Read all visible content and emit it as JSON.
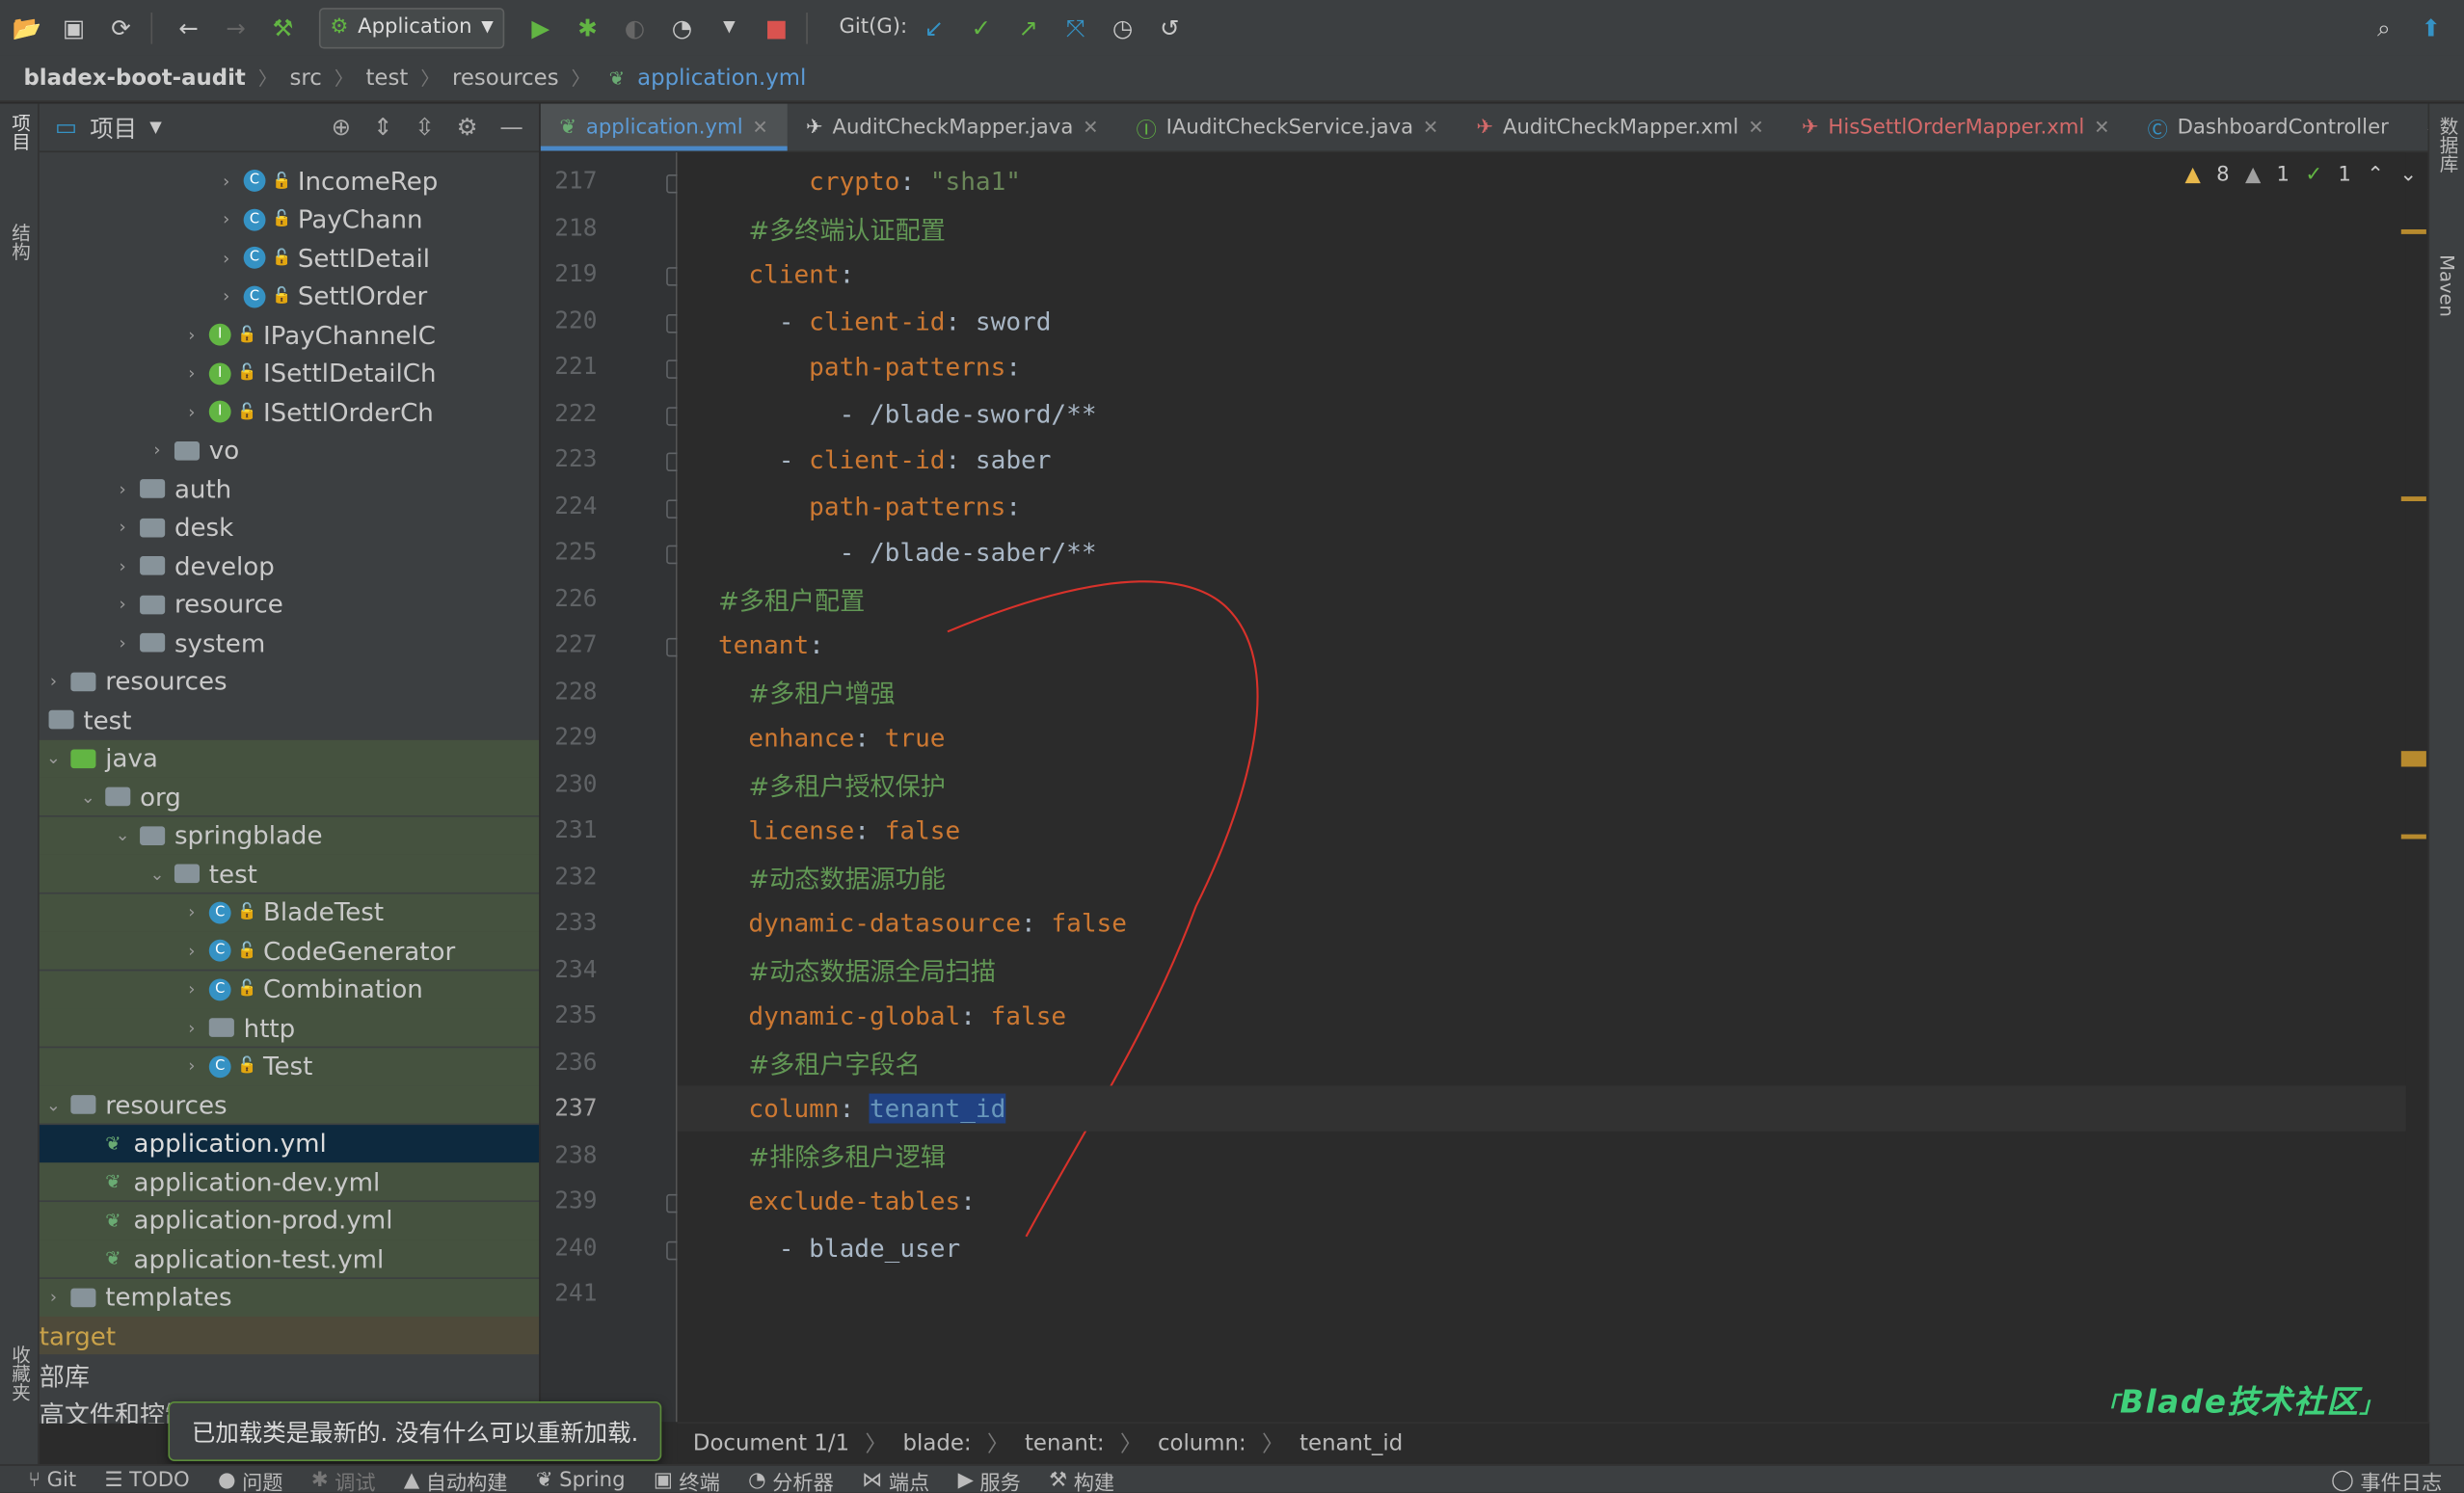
{
  "toolbar": {
    "run_config": "Application",
    "git_label": "Git(G):"
  },
  "breadcrumb": [
    "bladex-boot-audit",
    "src",
    "test",
    "resources",
    "application.yml"
  ],
  "left_stripe": {
    "project": "项目",
    "structure": "结构",
    "favorites": "收藏夹"
  },
  "right_stripe": {
    "database": "数据库",
    "maven": "Maven"
  },
  "project_panel": {
    "title": "项目",
    "rows": [
      {
        "label": "IncomeRep",
        "kind": "class",
        "depth": 5
      },
      {
        "label": "PayChann",
        "kind": "class",
        "depth": 5
      },
      {
        "label": "SettlDetail",
        "kind": "class",
        "depth": 5
      },
      {
        "label": "SettlOrder",
        "kind": "class",
        "depth": 5
      },
      {
        "label": "IPayChannelC",
        "kind": "interface",
        "depth": 4
      },
      {
        "label": "ISettlDetailCh",
        "kind": "interface",
        "depth": 4
      },
      {
        "label": "ISettlOrderCh",
        "kind": "interface",
        "depth": 4
      },
      {
        "label": "vo",
        "kind": "folder",
        "depth": 3
      },
      {
        "label": "auth",
        "kind": "folder",
        "depth": 2
      },
      {
        "label": "desk",
        "kind": "folder",
        "depth": 2
      },
      {
        "label": "develop",
        "kind": "folder",
        "depth": 2
      },
      {
        "label": "resource",
        "kind": "folder",
        "depth": 2
      },
      {
        "label": "system",
        "kind": "folder",
        "depth": 2
      },
      {
        "label": "resources",
        "kind": "folder",
        "depth": 0
      },
      {
        "label": "test",
        "kind": "folder-plain",
        "depth": 0
      },
      {
        "label": "java",
        "kind": "folder-open",
        "depth": 0
      },
      {
        "label": "org",
        "kind": "folder-open",
        "depth": 1
      },
      {
        "label": "springblade",
        "kind": "folder-open",
        "depth": 2
      },
      {
        "label": "test",
        "kind": "folder-open",
        "depth": 3
      },
      {
        "label": "BladeTest",
        "kind": "class",
        "depth": 4
      },
      {
        "label": "CodeGenerator",
        "kind": "class",
        "depth": 4
      },
      {
        "label": "Combination",
        "kind": "class",
        "depth": 4
      },
      {
        "label": "http",
        "kind": "folder",
        "depth": 4
      },
      {
        "label": "Test",
        "kind": "class",
        "depth": 4
      },
      {
        "label": "resources",
        "kind": "folder-open",
        "depth": 0
      },
      {
        "label": "application.yml",
        "kind": "yml",
        "depth": 1
      },
      {
        "label": "application-dev.yml",
        "kind": "yml",
        "depth": 1
      },
      {
        "label": "application-prod.yml",
        "kind": "yml",
        "depth": 1
      },
      {
        "label": "application-test.yml",
        "kind": "yml",
        "depth": 1
      },
      {
        "label": "templates",
        "kind": "folder",
        "depth": 0
      },
      {
        "label": "target",
        "kind": "target",
        "depth": -1
      },
      {
        "label": "部库",
        "kind": "plain",
        "depth": -1
      },
      {
        "label": "高文件和控制",
        "kind": "plain",
        "depth": -1
      }
    ]
  },
  "tabs": [
    {
      "label": "application.yml",
      "active": true
    },
    {
      "label": "AuditCheckMapper.java"
    },
    {
      "label": "IAuditCheckService.java"
    },
    {
      "label": "AuditCheckMapper.xml"
    },
    {
      "label": "HisSettlOrderMapper.xml",
      "red": true
    },
    {
      "label": "DashboardController"
    }
  ],
  "inspection": {
    "warnings": "8",
    "weak": "1",
    "ok": "1"
  },
  "code": {
    "current_line": 237,
    "lines": [
      {
        "no": 217,
        "parts": [
          [
            "      ",
            "p"
          ],
          [
            "crypto",
            "k"
          ],
          [
            ": ",
            "p"
          ],
          [
            "\"sha1\"",
            "s"
          ]
        ]
      },
      {
        "no": 218,
        "parts": [
          [
            "  ",
            "p"
          ],
          [
            "#多终端认证配置",
            "c"
          ]
        ]
      },
      {
        "no": 219,
        "parts": [
          [
            "  ",
            "p"
          ],
          [
            "client",
            "k"
          ],
          [
            ":",
            "p"
          ]
        ]
      },
      {
        "no": 220,
        "parts": [
          [
            "    - ",
            "p"
          ],
          [
            "client-id",
            "k"
          ],
          [
            ": sword",
            "p"
          ]
        ]
      },
      {
        "no": 221,
        "parts": [
          [
            "      ",
            "p"
          ],
          [
            "path-patterns",
            "k"
          ],
          [
            ":",
            "p"
          ]
        ]
      },
      {
        "no": 222,
        "parts": [
          [
            "        - /blade-sword/**",
            "p"
          ]
        ]
      },
      {
        "no": 223,
        "parts": [
          [
            "    - ",
            "p"
          ],
          [
            "client-id",
            "k"
          ],
          [
            ": saber",
            "p"
          ]
        ]
      },
      {
        "no": 224,
        "parts": [
          [
            "      ",
            "p"
          ],
          [
            "path-patterns",
            "k"
          ],
          [
            ":",
            "p"
          ]
        ]
      },
      {
        "no": 225,
        "parts": [
          [
            "        - /blade-saber/**",
            "p"
          ]
        ]
      },
      {
        "no": 226,
        "parts": [
          [
            "#多租户配置",
            "c"
          ]
        ]
      },
      {
        "no": 227,
        "parts": [
          [
            "tenant",
            "k"
          ],
          [
            ":",
            "p"
          ]
        ]
      },
      {
        "no": 228,
        "parts": [
          [
            "  ",
            "p"
          ],
          [
            "#多租户增强",
            "c"
          ]
        ]
      },
      {
        "no": 229,
        "parts": [
          [
            "  ",
            "p"
          ],
          [
            "enhance",
            "k"
          ],
          [
            ": ",
            "p"
          ],
          [
            "true",
            "k"
          ]
        ]
      },
      {
        "no": 230,
        "parts": [
          [
            "  ",
            "p"
          ],
          [
            "#多租户授权保护",
            "c"
          ]
        ]
      },
      {
        "no": 231,
        "parts": [
          [
            "  ",
            "p"
          ],
          [
            "license",
            "k"
          ],
          [
            ": ",
            "p"
          ],
          [
            "false",
            "k"
          ]
        ]
      },
      {
        "no": 232,
        "parts": [
          [
            "  ",
            "p"
          ],
          [
            "#动态数据源功能",
            "c"
          ]
        ]
      },
      {
        "no": 233,
        "parts": [
          [
            "  ",
            "p"
          ],
          [
            "dynamic-datasource",
            "k"
          ],
          [
            ": ",
            "p"
          ],
          [
            "false",
            "k"
          ]
        ]
      },
      {
        "no": 234,
        "parts": [
          [
            "  ",
            "p"
          ],
          [
            "#动态数据源全局扫描",
            "c"
          ]
        ]
      },
      {
        "no": 235,
        "parts": [
          [
            "  ",
            "p"
          ],
          [
            "dynamic-global",
            "k"
          ],
          [
            ": ",
            "p"
          ],
          [
            "false",
            "k"
          ]
        ]
      },
      {
        "no": 236,
        "parts": [
          [
            "  ",
            "p"
          ],
          [
            "#多租户字段名",
            "c"
          ]
        ]
      },
      {
        "no": 237,
        "parts": [
          [
            "  ",
            "p"
          ],
          [
            "column",
            "k"
          ],
          [
            ": ",
            "p"
          ],
          [
            "tenant_id",
            "selword"
          ]
        ]
      },
      {
        "no": 238,
        "parts": [
          [
            "  ",
            "p"
          ],
          [
            "#排除多租户逻辑",
            "c"
          ]
        ]
      },
      {
        "no": 239,
        "parts": [
          [
            "  ",
            "p"
          ],
          [
            "exclude-tables",
            "k"
          ],
          [
            ":",
            "p"
          ]
        ]
      },
      {
        "no": 240,
        "parts": [
          [
            "    - blade_user",
            "p"
          ]
        ]
      },
      {
        "no": 241,
        "parts": [
          [
            "",
            "p"
          ]
        ]
      }
    ]
  },
  "editor_breadcrumb": [
    "Document 1/1",
    "blade:",
    "tenant:",
    "column:",
    "tenant_id"
  ],
  "toast": "已加载类是最新的. 没有什么可以重新加载.",
  "watermark": "Blade技术社区",
  "bottom_bar": [
    "Git",
    "TODO",
    "问题",
    "调试",
    "自动构建",
    "Spring",
    "终端",
    "分析器",
    "端点",
    "服务",
    "构建",
    "事件日志"
  ]
}
